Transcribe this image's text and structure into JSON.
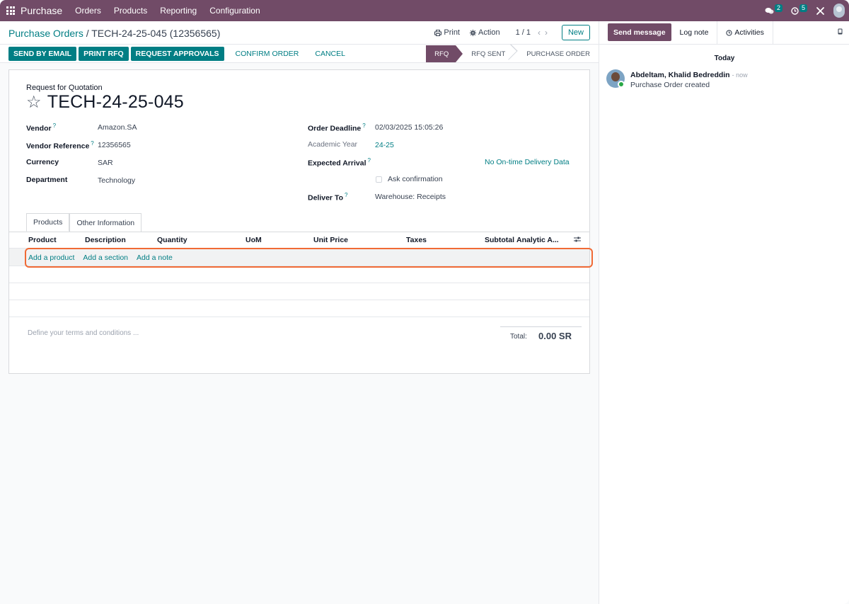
{
  "navbar": {
    "app_name": "Purchase",
    "menu": [
      "Orders",
      "Products",
      "Reporting",
      "Configuration"
    ],
    "messages_count": "2",
    "activities_count": "5"
  },
  "breadcrumb": {
    "parent": "Purchase Orders",
    "separator": "/",
    "current": "TECH-24-25-045 (12356565)"
  },
  "control_panel": {
    "print_label": "Print",
    "action_label": "Action",
    "pager": "1 / 1",
    "new_label": "New"
  },
  "statusbar": {
    "buttons": [
      "SEND BY EMAIL",
      "PRINT RFQ",
      "REQUEST APPROVALS"
    ],
    "link_buttons": [
      "CONFIRM ORDER",
      "CANCEL"
    ],
    "stages": [
      "RFQ",
      "RFQ SENT",
      "PURCHASE ORDER"
    ],
    "active_stage": "RFQ"
  },
  "form": {
    "subtitle": "Request for Quotation",
    "title": "TECH-24-25-045",
    "left_fields": [
      {
        "label": "Vendor",
        "help": "?",
        "value": "Amazon.SA"
      },
      {
        "label": "Vendor Reference",
        "help": "?",
        "value": "12356565"
      },
      {
        "label": "Currency",
        "help": "",
        "value": "SAR"
      },
      {
        "label": "Department",
        "help": "",
        "value": "Technology"
      }
    ],
    "right_fields": {
      "order_deadline_label": "Order Deadline",
      "order_deadline_value": "02/03/2025 15:05:26",
      "academic_year_label": "Academic Year",
      "academic_year_value": "24-25",
      "expected_arrival_label": "Expected Arrival",
      "no_ontime_label": "No On-time Delivery Data",
      "ask_confirmation_label": "Ask confirmation",
      "deliver_to_label": "Deliver To",
      "deliver_to_value": "Warehouse: Receipts"
    },
    "help_mark": "?",
    "tabs": [
      "Products",
      "Other Information"
    ],
    "columns": [
      "Product",
      "Description",
      "Quantity",
      "UoM",
      "Unit Price",
      "Taxes",
      "Subtotal",
      "Analytic A..."
    ],
    "add_links": [
      "Add a product",
      "Add a section",
      "Add a note"
    ],
    "terms_placeholder": "Define your terms and conditions ...",
    "total_label": "Total:",
    "total_value": "0.00 SR"
  },
  "chatter": {
    "send_message": "Send message",
    "log_note": "Log note",
    "activities": "Activities",
    "date_separator": "Today",
    "message_author": "Abdeltam, Khalid Bedreddin",
    "message_time": "- now",
    "message_body": "Purchase Order created"
  },
  "colors": {
    "brand": "#714b67",
    "accent": "#017e84",
    "highlight": "#f06a35"
  }
}
